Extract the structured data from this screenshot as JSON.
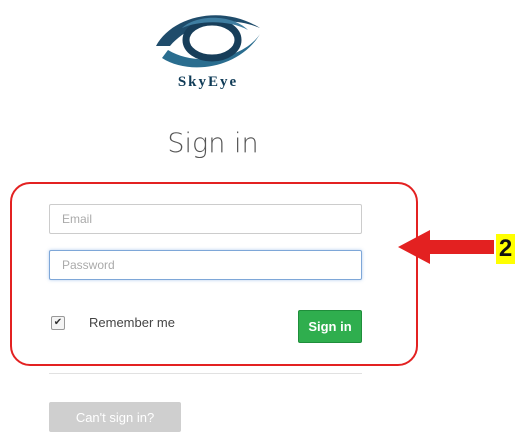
{
  "brand": {
    "name": "SkyEye",
    "logo_icon": "eye-logo-icon",
    "color": "#0f3b57"
  },
  "heading": "Sign in",
  "form": {
    "email_placeholder": "Email",
    "password_placeholder": "Password",
    "remember_label": "Remember me",
    "remember_checked": true,
    "signin_label": "Sign in"
  },
  "cant_signin_label": "Can't sign in?",
  "annotation": {
    "step_number": "2",
    "highlight_color": "#e32121",
    "badge_color": "#ffff00"
  },
  "colors": {
    "primary_button": "#2fae4e",
    "disabled_button": "#cfcfcf"
  }
}
